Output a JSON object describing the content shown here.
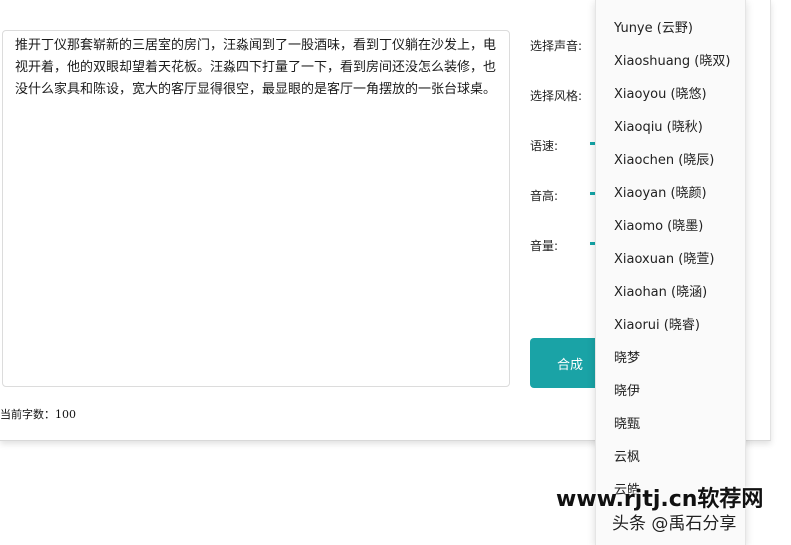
{
  "editor": {
    "text": "推开丁仪那套崭新的三居室的房门，汪淼闻到了一股酒味，看到丁仪躺在沙发上，电视开着，他的双眼却望着天花板。汪淼四下打量了一下，看到房间还没怎么装修，也没什么家具和陈设，宽大的客厅显得很空，最显眼的是客厅一角摆放的一张台球桌。",
    "char_count_label": "当前字数：100"
  },
  "form": {
    "voice_label": "选择声音:",
    "style_label": "选择风格:",
    "speed_label": "语速:",
    "pitch_label": "音高:",
    "volume_label": "音量:",
    "synthesize_button": "合成"
  },
  "dropdown": {
    "items": [
      "Yunye (云野)",
      "Xiaoshuang (晓双)",
      "Xiaoyou (晓悠)",
      "Xiaoqiu (晓秋)",
      "Xiaochen (晓辰)",
      "Xiaoyan (晓颜)",
      "Xiaomo (晓墨)",
      "Xiaoxuan (晓萱)",
      "Xiaohan (晓涵)",
      "Xiaorui (晓睿)",
      "晓梦",
      "晓伊",
      "晓甄",
      "云枫",
      "云皓"
    ]
  },
  "watermark": {
    "site": "www.rjtj.cn软荐网",
    "credit": "头条 @禹石分享"
  },
  "colors": {
    "accent": "#1aa3a6"
  }
}
